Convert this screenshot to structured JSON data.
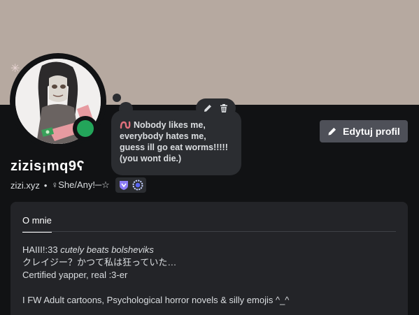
{
  "profile": {
    "display_name": "zizis¡mq9ʕ",
    "username": "zizi.xyz",
    "pronouns": "♀She/Any!─☆",
    "status": "online",
    "colors": {
      "banner": "#b6a9a0",
      "status_online": "#23a55a",
      "button": "#4e5058",
      "worm": "#e0707c"
    }
  },
  "custom_status": {
    "line1": "Nobody likes me,",
    "line2": "everybody hates me,",
    "line3": "guess ill go eat worms!!!!!",
    "line4": "(you wont die.)",
    "emoji_icon": "worm-icon"
  },
  "actions": {
    "edit_profile_label": "Edytuj profil",
    "edit_status_icon": "pencil-icon",
    "delete_status_icon": "trash-icon"
  },
  "about": {
    "tab_label": "O mnie",
    "line1_plain": "HAIII!:33 ",
    "line1_italic": "cutely beats bolsheviks",
    "line2": "クレイジー？かつて私は狂っていた…",
    "line3": "Certified yapper, real :3-er",
    "line4": "I FW Adult cartoons, Psychological horror novels & silly emojis ^_^"
  }
}
